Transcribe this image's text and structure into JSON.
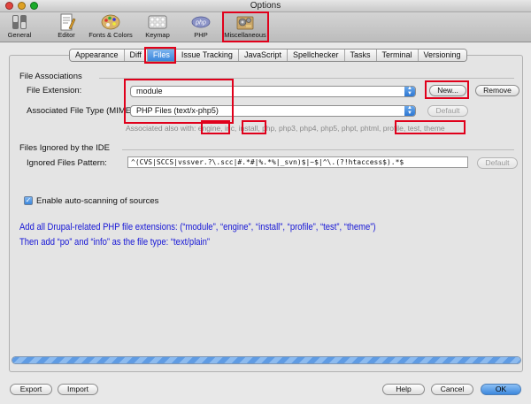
{
  "window": {
    "title": "Options"
  },
  "toolbar": {
    "items": [
      {
        "label": "General",
        "icon": "switch-icon"
      },
      {
        "label": "Editor",
        "icon": "editor-icon"
      },
      {
        "label": "Fonts & Colors",
        "icon": "palette-icon"
      },
      {
        "label": "Keymap",
        "icon": "keyboard-icon"
      },
      {
        "label": "PHP",
        "icon": "php-icon",
        "icon_text": "php"
      },
      {
        "label": "Miscellaneous",
        "icon": "misc-icon",
        "selected": true
      }
    ]
  },
  "tabs": [
    {
      "label": "Appearance"
    },
    {
      "label": "Diff"
    },
    {
      "label": "Files",
      "active": true
    },
    {
      "label": "Issue Tracking"
    },
    {
      "label": "JavaScript"
    },
    {
      "label": "Spellchecker"
    },
    {
      "label": "Tasks"
    },
    {
      "label": "Terminal"
    },
    {
      "label": "Versioning"
    }
  ],
  "file_associations": {
    "heading": "File Associations",
    "extension_label": "File Extension:",
    "extension_value": "module",
    "new_button": "New...",
    "remove_button": "Remove",
    "mime_label": "Associated File Type (MIME):",
    "mime_value": "PHP Files (text/x-php5)",
    "default_button": "Default",
    "also_with_label": "Associated also with:",
    "also_with": [
      "engine",
      "inc",
      "install",
      "php",
      "php3",
      "php4",
      "php5",
      "phpt",
      "phtml",
      "profile",
      "test",
      "theme"
    ]
  },
  "ignored": {
    "heading": "Files Ignored by the IDE",
    "pattern_label": "Ignored Files Pattern:",
    "pattern_value": "^(CVS|SCCS|vssver.?\\.scc|#.*#|%.*%|_svn)$|~$|^\\.(?!htaccess$).*$",
    "default_button": "Default"
  },
  "auto_scan": {
    "label": "Enable auto-scanning of sources",
    "checked": true
  },
  "instructions": {
    "line1": "Add all Drupal-related PHP file extensions: (“module”, “engine”, “install”, “profile”, “test”, “theme”)",
    "line2": "Then add “po” and “info” as the file type: “text/plain”"
  },
  "progress": {
    "value": 1.0
  },
  "footer": {
    "export": "Export",
    "import": "Import",
    "help": "Help",
    "cancel": "Cancel",
    "ok": "OK"
  },
  "colors": {
    "highlight": "#e0001b",
    "instruction_text": "#1515d6",
    "accent": "#3a86dc"
  }
}
